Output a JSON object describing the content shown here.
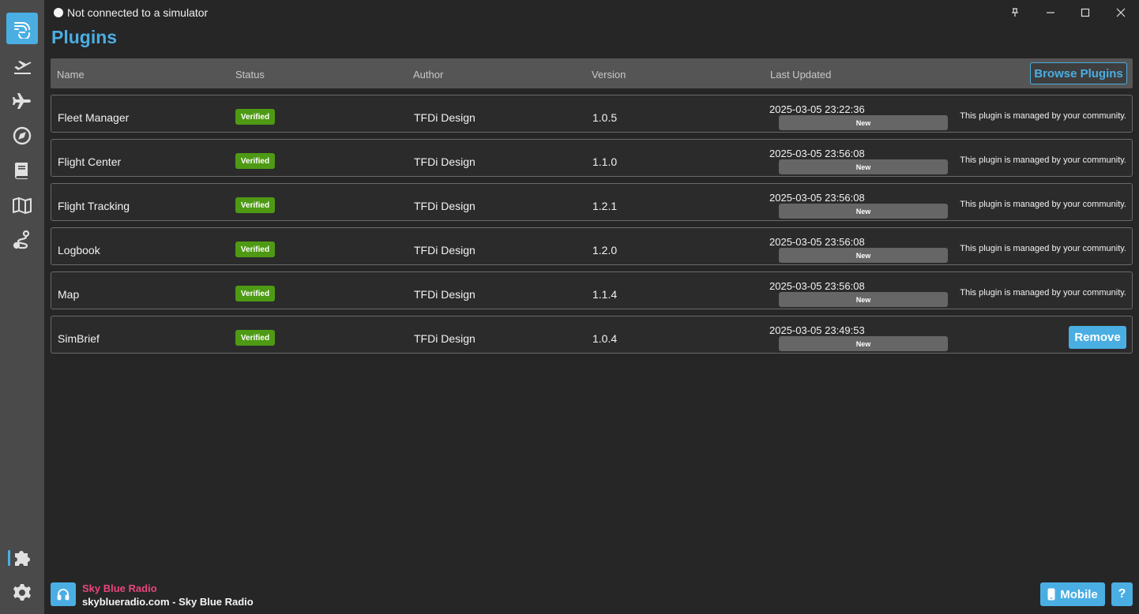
{
  "titlebar": {
    "connection_status": "Not connected to a simulator",
    "pin_icon": "pin-icon",
    "minimize_icon": "minimize-icon",
    "maximize_icon": "maximize-icon",
    "close_icon": "close-icon"
  },
  "sidebar": {
    "items": [
      {
        "name": "app-logo",
        "icon": "smartcars-logo-icon",
        "active": true
      },
      {
        "name": "flights",
        "icon": "departure-icon",
        "active": false
      },
      {
        "name": "aircraft",
        "icon": "plane-icon",
        "active": false
      },
      {
        "name": "navigation",
        "icon": "compass-icon",
        "active": false
      },
      {
        "name": "logbook",
        "icon": "book-icon",
        "active": false
      },
      {
        "name": "map",
        "icon": "map-icon",
        "active": false
      },
      {
        "name": "route",
        "icon": "route-icon",
        "active": false
      },
      {
        "name": "plugins",
        "icon": "puzzle-icon",
        "active": true
      },
      {
        "name": "settings",
        "icon": "gear-icon",
        "active": false
      }
    ]
  },
  "page": {
    "title": "Plugins"
  },
  "table": {
    "headers": {
      "name": "Name",
      "status": "Status",
      "author": "Author",
      "version": "Version",
      "last_updated": "Last Updated"
    },
    "browse_label": "Browse Plugins",
    "rows": [
      {
        "name": "Fleet Manager",
        "status": "Verified",
        "author": "TFDi Design",
        "version": "1.0.5",
        "updated": "2025-03-05 23:22:36",
        "tag": "New",
        "note": "This plugin is managed by your community."
      },
      {
        "name": "Flight Center",
        "status": "Verified",
        "author": "TFDi Design",
        "version": "1.1.0",
        "updated": "2025-03-05 23:56:08",
        "tag": "New",
        "note": "This plugin is managed by your community."
      },
      {
        "name": "Flight Tracking",
        "status": "Verified",
        "author": "TFDi Design",
        "version": "1.2.1",
        "updated": "2025-03-05 23:56:08",
        "tag": "New",
        "note": "This plugin is managed by your community."
      },
      {
        "name": "Logbook",
        "status": "Verified",
        "author": "TFDi Design",
        "version": "1.2.0",
        "updated": "2025-03-05 23:56:08",
        "tag": "New",
        "note": "This plugin is managed by your community."
      },
      {
        "name": "Map",
        "status": "Verified",
        "author": "TFDi Design",
        "version": "1.1.4",
        "updated": "2025-03-05 23:56:08",
        "tag": "New",
        "note": "This plugin is managed by your community."
      },
      {
        "name": "SimBrief",
        "status": "Verified",
        "author": "TFDi Design",
        "version": "1.0.4",
        "updated": "2025-03-05 23:49:53",
        "tag": "New",
        "action": "Remove"
      }
    ]
  },
  "footer": {
    "radio_icon": "headphones-icon",
    "radio_name": "Sky Blue Radio",
    "radio_sub": "skyblueradio.com - Sky Blue Radio",
    "mobile_icon": "phone-icon",
    "mobile_label": "Mobile",
    "help_label": "?"
  },
  "colors": {
    "accent": "#4aaee3",
    "verified": "#4e9a14",
    "radio_name": "#e8467c",
    "sidebar": "#4a4a4a",
    "background": "#262626"
  }
}
